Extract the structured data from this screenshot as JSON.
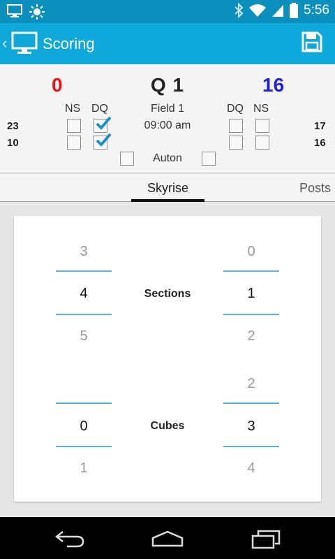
{
  "status_bar": {
    "time": "5:56"
  },
  "action_bar": {
    "title": "Scoring"
  },
  "match": {
    "red_score": "0",
    "blue_score": "16",
    "name": "Q 1",
    "field": "Field 1",
    "time": "09:00 am",
    "red_teams": [
      "23",
      "10"
    ],
    "blue_teams": [
      "17",
      "16"
    ],
    "red_headers": {
      "ns": "NS",
      "dq": "DQ"
    },
    "blue_headers": {
      "dq": "DQ",
      "ns": "NS"
    },
    "auton_label": "Auton",
    "checkboxes": {
      "red_ns": [
        false,
        false
      ],
      "red_dq": [
        true,
        true
      ],
      "blue_dq": [
        false,
        false
      ],
      "blue_ns": [
        false,
        false
      ],
      "auton_red": false,
      "auton_blue": false
    }
  },
  "tabs": {
    "active": "Skyrise",
    "next": "Posts"
  },
  "scoring": {
    "sections": {
      "label": "Sections",
      "red": {
        "above": "3",
        "value": "4",
        "below": "5"
      },
      "blue": {
        "above": "0",
        "value": "1",
        "below": "2"
      }
    },
    "cubes": {
      "label": "Cubes",
      "red": {
        "above": "",
        "value": "0",
        "below": "1"
      },
      "blue": {
        "above": "2",
        "value": "3",
        "below": "4"
      }
    }
  },
  "colors": {
    "status_bar": "#0b8fbd",
    "action_bar": "#0ea8da",
    "red": "#ee1111",
    "blue": "#1f1fe0",
    "picker_line": "#5ab5e6",
    "check": "#1a8fd0"
  }
}
